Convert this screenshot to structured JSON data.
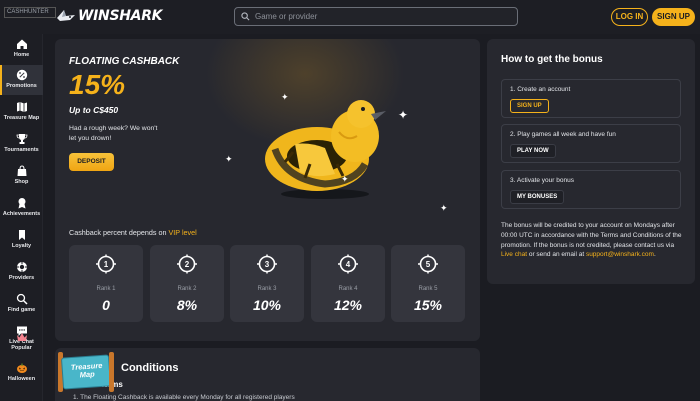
{
  "header": {
    "badge": "CASHHUNTER",
    "brand": "WINSHARK",
    "search_placeholder": "Game or provider",
    "login_label": "LOG IN",
    "signup_label": "SIGN UP"
  },
  "sidebar": {
    "items": [
      {
        "label": "Home",
        "icon": "home-icon"
      },
      {
        "label": "Promotions",
        "icon": "percent-icon"
      },
      {
        "label": "Treasure Map",
        "icon": "map-icon"
      },
      {
        "label": "Tournaments",
        "icon": "trophy-icon"
      },
      {
        "label": "Shop",
        "icon": "bag-icon"
      },
      {
        "label": "Achievements",
        "icon": "medal-icon"
      },
      {
        "label": "Loyalty",
        "icon": "bookmark-icon"
      },
      {
        "label": "Providers",
        "icon": "chip-icon"
      },
      {
        "label": "Find game",
        "icon": "search-icon"
      },
      {
        "label": "Live Chat",
        "icon": "chat-icon"
      },
      {
        "label": "Popular",
        "icon": "crown-icon"
      },
      {
        "label": "Halloween",
        "icon": "pumpkin-icon"
      }
    ],
    "active_index": 1
  },
  "hero": {
    "title": "FLOATING CASHBACK",
    "percent": "15%",
    "up_to": "Up to C$450",
    "description": "Had a rough week? We won't let you drown!",
    "deposit_label": "DEPOSIT",
    "vip_prefix": "Cashback percent depends on ",
    "vip_link": "VIP level"
  },
  "ranks": [
    {
      "number": "1",
      "label": "Rank 1",
      "value": "0"
    },
    {
      "number": "2",
      "label": "Rank 2",
      "value": "8%"
    },
    {
      "number": "3",
      "label": "Rank 3",
      "value": "10%"
    },
    {
      "number": "4",
      "label": "Rank 4",
      "value": "12%"
    },
    {
      "number": "5",
      "label": "Rank 5",
      "value": "15%"
    }
  ],
  "conditions": {
    "title": "Conditions",
    "subtitle": "General terms",
    "first_line": "1. The Floating Cashback is available every Monday for all registered players"
  },
  "treasure_widget": {
    "label": "Treasure Map"
  },
  "bonus": {
    "title": "How to get the bonus",
    "steps": [
      {
        "text": "1. Create an account",
        "button": "SIGN UP",
        "style": "gold"
      },
      {
        "text": "2. Play games all week and have fun",
        "button": "PLAY NOW",
        "style": "dark"
      },
      {
        "text": "3. Activate your bonus",
        "button": "MY BONUSES",
        "style": "dark"
      }
    ],
    "note_before": "The bonus will be credited to your account on Mondays after 00:00 UTC in accordance with the Terms and Conditions of the promotion. If the bonus is not credited, please contact us via ",
    "note_link1": "Live chat",
    "note_middle": " or send an email at ",
    "note_link2": "support@winshark.com",
    "note_end": "."
  },
  "colors": {
    "accent": "#f5b21b",
    "background": "#1b1c22",
    "card": "#27282f",
    "rank_card": "#34353d"
  }
}
